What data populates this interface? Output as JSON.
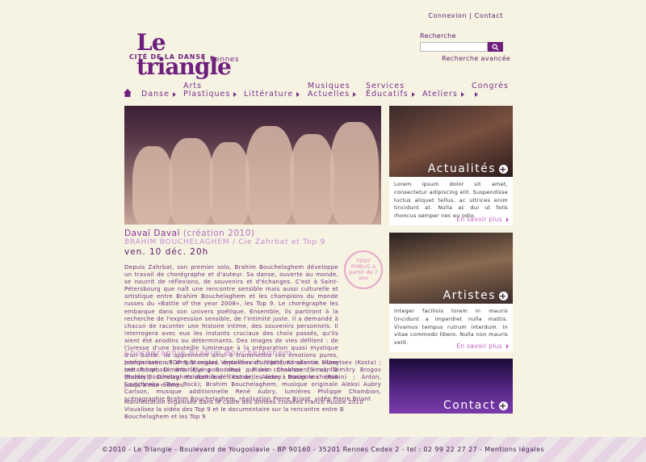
{
  "topnav": {
    "login": "Connexion",
    "separator": "|",
    "contact": "Contact"
  },
  "logo": {
    "main": "Le triangle",
    "tagline": "CITÉ DE LA DANSE",
    "city": "Rennes"
  },
  "search": {
    "label": "Recherche",
    "placeholder": "",
    "advanced": "Recherche avancée"
  },
  "nav": {
    "items": [
      {
        "label": "Danse"
      },
      {
        "label": "Arts\nPlastiques"
      },
      {
        "label": "Littérature"
      },
      {
        "label": "Musiques\nActuelles"
      },
      {
        "label": "Services\nÉducatifs"
      },
      {
        "label": "Ateliers"
      },
      {
        "label": "Congrès"
      }
    ]
  },
  "article": {
    "title": "Davaï Davaï",
    "title_suffix": " (création 2010)",
    "author": "BRAHIM BOUCHELAGHEM / Cie Zahrbat et Top 9",
    "date": "ven. 10 déc. 20h",
    "badge": "TOUT PUBLIC à partir de 7 ans",
    "body": "Depuis Zahrbat, son premier solo, Brahim Bouchelaghem développe un travail de chorégraphe et d'auteur. Sa danse, ouverte au monde, se nourrit de réflexions, de souvenirs et d'échanges. C'est à Saint-Pétersbourg que naît une rencontre sensible mais aussi culturelle et artistique entre Brahim Bouchelaghem et les champions du monde russes du «Battle of the year 2008», les Top 9. Le chorégraphe les embarque dans son univers poétique. Ensemble, ils partiront à la recherche de l'expression sensible, de l'intimité juste. Il a demandé à chacun de raconter une histoire intime, des souvenirs personnels. Il interrogera avec eux les instants cruciaux des choix passés, qu'ils aient été anodins ou déterminants. Des images de vies défilent : de l'ivresse d'une bouteille lumineuse à la préparation quasi mystique d'un battle. Ils apprennent ainsi à transmettre ces émotions pures, parfois avec un simple regard, émaillées d'un profond silence. «Une métamorphose artistique pour ceux qui les connaissent.» confie Brahim Bouchelaghem dont le défi est de les aider à tracer le chemin jusqu'à eux-mêmes."
  },
  "credits": {
    "title": "Chorégraphie Brahim Bouchelaghem",
    "text": "Interprétation TOP 9 Stanislav Vaytekhovich (Wolt); Konstantin Eliseytsev (Kosta) ; Lee Tchan, Dimitro (Flying Buddha) ; Maxim Chakhov (Sims); Dimitry Brogov (Rezkiy); Dimitry Kolokolnikov (Kamar); Alexey Bonigokov (Robin) ; Anton, Savtchenko (Tony Rock); Brahim Bouchelaghem, musique originale Aleksi Aubry Carlson, musique additionnelle René Aubry, lumières Philippe Chambion, scénographie Brahim Bouchelaghem, réalisation Pierre Briant, vidéo Pierre Briant",
    "manif": "Manifestation organisée dans le cadre des années croisées France Russie 2010 Visualisez la vidéo des Top 9 et le documentaire sur la rencontre entre B Bouchelaghem et les Top 9"
  },
  "cards": [
    {
      "title": "Actualités",
      "text": "Lorem ipsum dolor sit amet, consectetur adipiscing elit. Suspendisse luctus aliquet tellus, ac ultrices enim tincidunt at. Nulla ac dui ut felis rhoncus semper nec eu odio.",
      "more": "En savoir plus"
    },
    {
      "title": "Artistes",
      "text": "Integer facilisis lorem in mauris tincidunt a imperdiet nulla mattis. Vivamus tempus rutrum interdum. In vitae commodo libero. Nulla non mauris velit.",
      "more": "En savoir plus"
    },
    {
      "title": "Contact"
    }
  ],
  "footer": {
    "text": "©2010 - Le Triangle - Boulevard de Yougoslavie - BP 90160 - 35201 Rennes Cedex 2 - tel : 02 99 22 27 27 - Mentions légales"
  }
}
